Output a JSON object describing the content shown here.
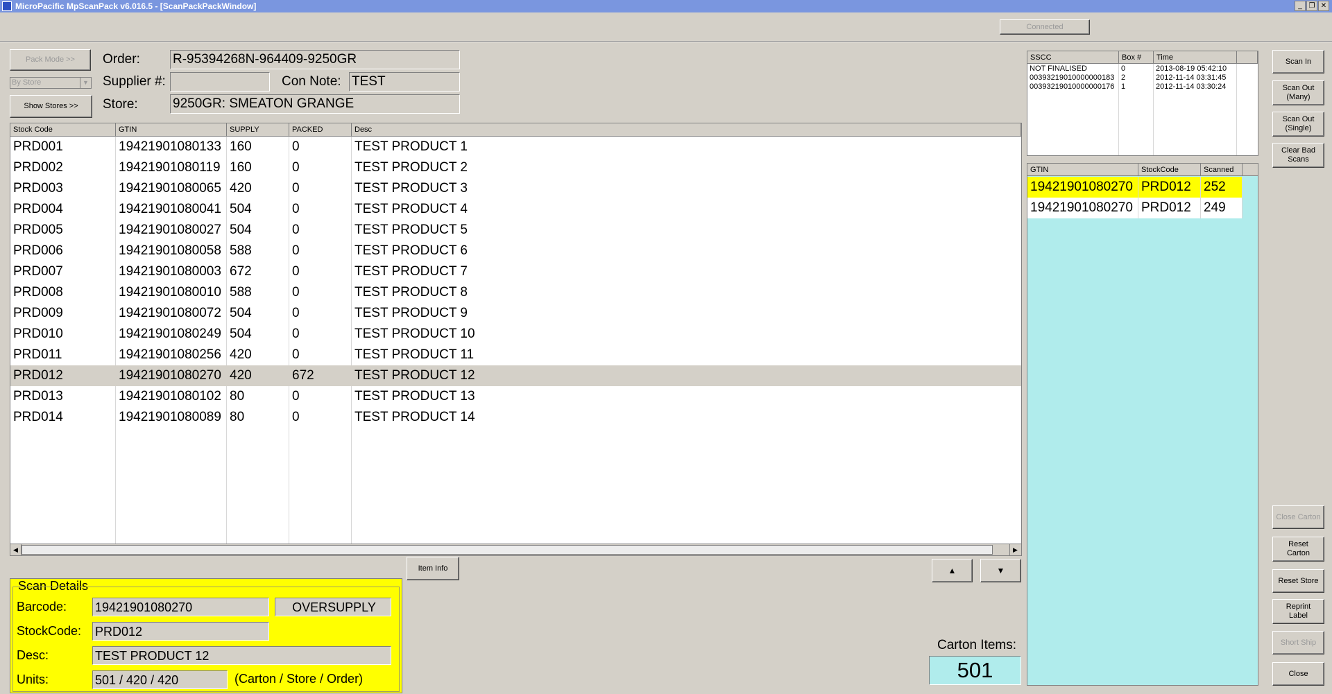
{
  "window": {
    "title": "MicroPacific MpScanPack v6.016.5 - [ScanPackPackWindow]",
    "status": "Connected"
  },
  "left_controls": {
    "pack_mode": "Pack Mode >>",
    "by_store": "By Store",
    "show_stores": "Show Stores >>"
  },
  "order": {
    "order_label": "Order:",
    "order_value": "R-95394268N-964409-9250GR",
    "supplier_label": "Supplier #:",
    "supplier_value": "",
    "con_note_label": "Con Note:",
    "con_note_value": "TEST",
    "store_label": "Store:",
    "store_value": "9250GR: SMEATON GRANGE"
  },
  "product_table": {
    "columns": [
      "Stock Code",
      "GTIN",
      "SUPPLY",
      "PACKED",
      "Desc"
    ],
    "rows": [
      [
        "PRD001",
        "19421901080133",
        "160",
        "0",
        "TEST PRODUCT 1"
      ],
      [
        "PRD002",
        "19421901080119",
        "160",
        "0",
        "TEST PRODUCT 2"
      ],
      [
        "PRD003",
        "19421901080065",
        "420",
        "0",
        "TEST PRODUCT 3"
      ],
      [
        "PRD004",
        "19421901080041",
        "504",
        "0",
        "TEST PRODUCT 4"
      ],
      [
        "PRD005",
        "19421901080027",
        "504",
        "0",
        "TEST PRODUCT 5"
      ],
      [
        "PRD006",
        "19421901080058",
        "588",
        "0",
        "TEST PRODUCT 6"
      ],
      [
        "PRD007",
        "19421901080003",
        "672",
        "0",
        "TEST PRODUCT 7"
      ],
      [
        "PRD008",
        "19421901080010",
        "588",
        "0",
        "TEST PRODUCT 8"
      ],
      [
        "PRD009",
        "19421901080072",
        "504",
        "0",
        "TEST PRODUCT 9"
      ],
      [
        "PRD010",
        "19421901080249",
        "504",
        "0",
        "TEST PRODUCT 10"
      ],
      [
        "PRD011",
        "19421901080256",
        "420",
        "0",
        "TEST PRODUCT 11"
      ],
      [
        "PRD012",
        "19421901080270",
        "420",
        "672",
        "TEST PRODUCT 12"
      ],
      [
        "PRD013",
        "19421901080102",
        "80",
        "0",
        "TEST PRODUCT 13"
      ],
      [
        "PRD014",
        "19421901080089",
        "80",
        "0",
        "TEST PRODUCT 14"
      ]
    ],
    "selected_row": 11,
    "selected_color": "#d4d0c8"
  },
  "item_info_button": "Item Info",
  "scroll_up_icon": "triangle-up",
  "scroll_down_icon": "triangle-down",
  "scan_details": {
    "title": "Scan Details",
    "barcode_label": "Barcode:",
    "barcode_value": "19421901080270",
    "status_value": "OVERSUPPLY",
    "stockcode_label": "StockCode:",
    "stockcode_value": "PRD012",
    "desc_label": "Desc:",
    "desc_value": "TEST PRODUCT 12",
    "units_label": "Units:",
    "units_value": "501 / 420 / 420",
    "units_hint": "(Carton / Store / Order)",
    "bg_color": "#ffff00"
  },
  "carton": {
    "label": "Carton Items:",
    "value": "501",
    "bg_color": "#b0ecec"
  },
  "sscc_table": {
    "columns": [
      "SSCC",
      "Box #",
      "Time"
    ],
    "rows": [
      [
        "NOT FINALISED",
        "0",
        "2013-08-19 05:42:10"
      ],
      [
        "00393219010000000183",
        "2",
        "2012-11-14 03:31:45"
      ],
      [
        "00393219010000000176",
        "1",
        "2012-11-14 03:30:24"
      ]
    ]
  },
  "scanned_table": {
    "columns": [
      "GTIN",
      "StockCode",
      "Scanned"
    ],
    "rows": [
      [
        "19421901080270",
        "PRD012",
        "252"
      ],
      [
        "19421901080270",
        "PRD012",
        "249"
      ]
    ],
    "highlight_row": 0,
    "highlight_color": "#ffff00",
    "bg_color": "#b0ecec"
  },
  "right_buttons": {
    "scan_in": "Scan In",
    "scan_out_many": "Scan Out\n(Many)",
    "scan_out_single": "Scan Out\n(Single)",
    "clear_bad_scans": "Clear Bad\nScans",
    "close_carton": "Close Carton",
    "reset_carton": "Reset\nCarton",
    "reset_store": "Reset Store",
    "reprint_label": "Reprint\nLabel",
    "short_ship": "Short Ship",
    "close": "Close"
  }
}
